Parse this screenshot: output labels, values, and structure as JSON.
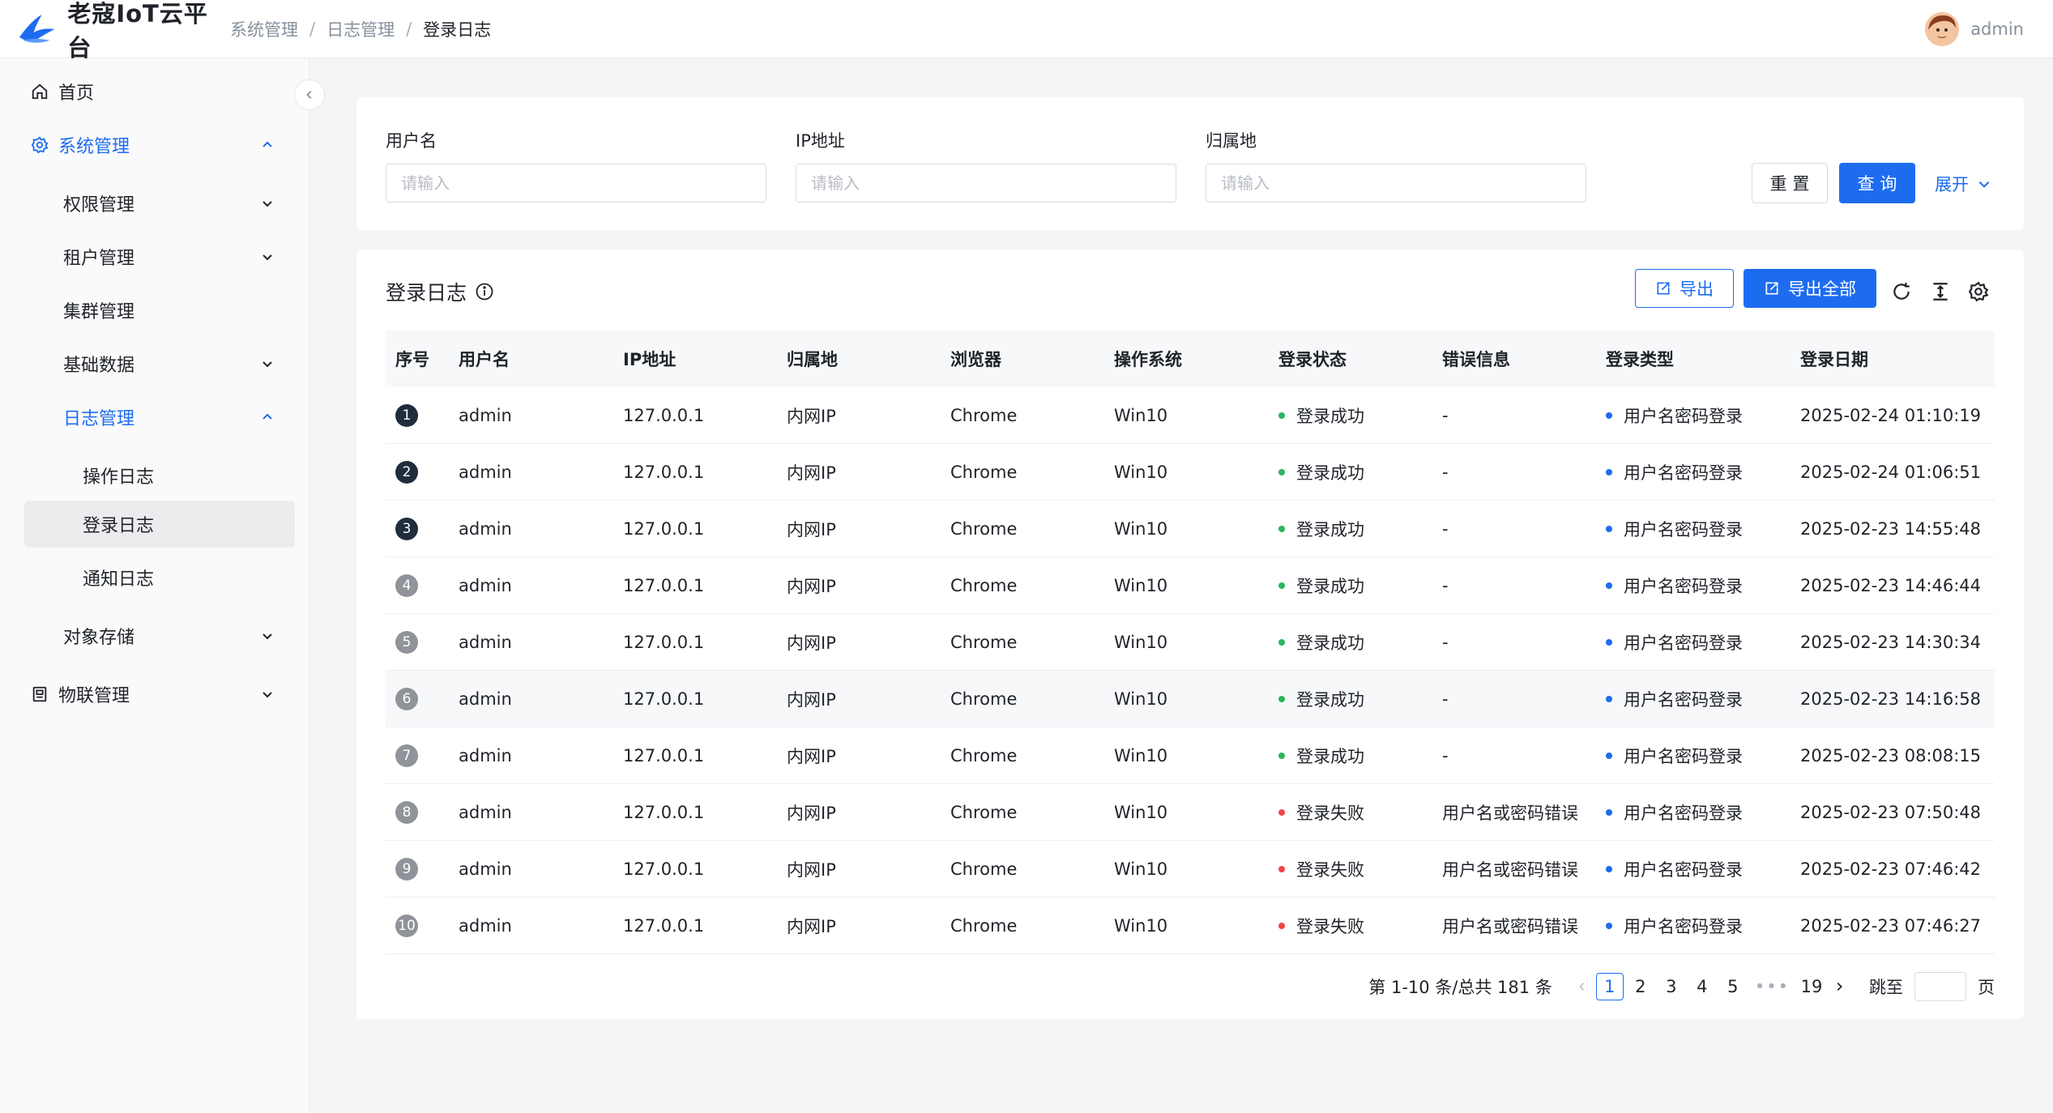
{
  "header": {
    "logo_text": "老寇IoT云平台",
    "breadcrumb": [
      "系统管理",
      "日志管理",
      "登录日志"
    ],
    "user_name": "admin"
  },
  "sidebar": {
    "items": [
      {
        "label": "首页",
        "icon": "home-icon"
      },
      {
        "label": "系统管理",
        "icon": "gear-icon"
      },
      {
        "label": "权限管理"
      },
      {
        "label": "租户管理"
      },
      {
        "label": "集群管理"
      },
      {
        "label": "基础数据"
      },
      {
        "label": "日志管理"
      },
      {
        "label": "操作日志"
      },
      {
        "label": "登录日志"
      },
      {
        "label": "通知日志"
      },
      {
        "label": "对象存储"
      },
      {
        "label": "物联管理",
        "icon": "device-icon"
      }
    ]
  },
  "filter": {
    "username_label": "用户名",
    "ip_label": "IP地址",
    "location_label": "归属地",
    "placeholder": "请输入",
    "reset_label": "重 置",
    "query_label": "查 询",
    "expand_label": "展开"
  },
  "table_card": {
    "title": "登录日志",
    "export_label": "导出",
    "export_all_label": "导出全部",
    "columns": [
      "序号",
      "用户名",
      "IP地址",
      "归属地",
      "浏览器",
      "操作系统",
      "登录状态",
      "错误信息",
      "登录类型",
      "登录日期"
    ],
    "rows": [
      {
        "no": "1",
        "user": "admin",
        "ip": "127.0.0.1",
        "loc": "内网IP",
        "browser": "Chrome",
        "os": "Win10",
        "status": "登录成功",
        "error": "-",
        "type": "用户名密码登录",
        "date": "2025-02-24 01:10:19"
      },
      {
        "no": "2",
        "user": "admin",
        "ip": "127.0.0.1",
        "loc": "内网IP",
        "browser": "Chrome",
        "os": "Win10",
        "status": "登录成功",
        "error": "-",
        "type": "用户名密码登录",
        "date": "2025-02-24 01:06:51"
      },
      {
        "no": "3",
        "user": "admin",
        "ip": "127.0.0.1",
        "loc": "内网IP",
        "browser": "Chrome",
        "os": "Win10",
        "status": "登录成功",
        "error": "-",
        "type": "用户名密码登录",
        "date": "2025-02-23 14:55:48"
      },
      {
        "no": "4",
        "user": "admin",
        "ip": "127.0.0.1",
        "loc": "内网IP",
        "browser": "Chrome",
        "os": "Win10",
        "status": "登录成功",
        "error": "-",
        "type": "用户名密码登录",
        "date": "2025-02-23 14:46:44"
      },
      {
        "no": "5",
        "user": "admin",
        "ip": "127.0.0.1",
        "loc": "内网IP",
        "browser": "Chrome",
        "os": "Win10",
        "status": "登录成功",
        "error": "-",
        "type": "用户名密码登录",
        "date": "2025-02-23 14:30:34"
      },
      {
        "no": "6",
        "user": "admin",
        "ip": "127.0.0.1",
        "loc": "内网IP",
        "browser": "Chrome",
        "os": "Win10",
        "status": "登录成功",
        "error": "-",
        "type": "用户名密码登录",
        "date": "2025-02-23 14:16:58"
      },
      {
        "no": "7",
        "user": "admin",
        "ip": "127.0.0.1",
        "loc": "内网IP",
        "browser": "Chrome",
        "os": "Win10",
        "status": "登录成功",
        "error": "-",
        "type": "用户名密码登录",
        "date": "2025-02-23 08:08:15"
      },
      {
        "no": "8",
        "user": "admin",
        "ip": "127.0.0.1",
        "loc": "内网IP",
        "browser": "Chrome",
        "os": "Win10",
        "status": "登录失败",
        "error": "用户名或密码错误",
        "type": "用户名密码登录",
        "date": "2025-02-23 07:50:48"
      },
      {
        "no": "9",
        "user": "admin",
        "ip": "127.0.0.1",
        "loc": "内网IP",
        "browser": "Chrome",
        "os": "Win10",
        "status": "登录失败",
        "error": "用户名或密码错误",
        "type": "用户名密码登录",
        "date": "2025-02-23 07:46:42"
      },
      {
        "no": "10",
        "user": "admin",
        "ip": "127.0.0.1",
        "loc": "内网IP",
        "browser": "Chrome",
        "os": "Win10",
        "status": "登录失败",
        "error": "用户名或密码错误",
        "type": "用户名密码登录",
        "date": "2025-02-23 07:46:27"
      }
    ]
  },
  "pagination": {
    "total_text": "第 1-10 条/总共 181 条",
    "pages": [
      "1",
      "2",
      "3",
      "4",
      "5"
    ],
    "dots": "•••",
    "last_page": "19",
    "jump_label": "跳至",
    "page_suffix": "页"
  },
  "colors": {
    "primary": "#1d6cf0",
    "success": "#2db55d",
    "error": "#f04646",
    "info": "#1d6cf0"
  }
}
